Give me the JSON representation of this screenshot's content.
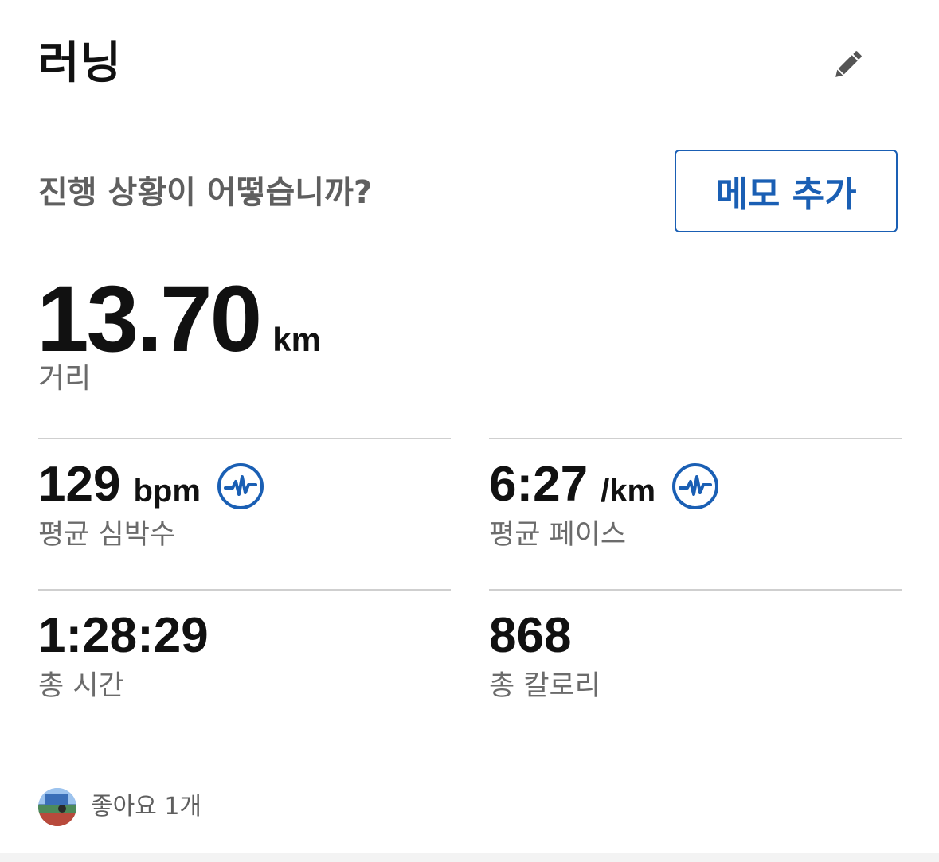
{
  "header": {
    "title": "러닝"
  },
  "prompt": {
    "question": "진행 상황이 어떻습니까?",
    "memo_button": "메모 추가"
  },
  "distance": {
    "value": "13.70",
    "unit": "km",
    "label": "거리"
  },
  "stats": [
    {
      "value": "129",
      "unit": "bpm",
      "label": "평균 심박수",
      "icon": "heart-rate-zone-icon"
    },
    {
      "value": "6:27",
      "unit": "/km",
      "label": "평균 페이스",
      "icon": "pace-zone-icon"
    },
    {
      "value": "1:28:29",
      "unit": "",
      "label": "총 시간"
    },
    {
      "value": "868",
      "unit": "",
      "label": "총 칼로리"
    }
  ],
  "likes": {
    "text": "좋아요 1개"
  },
  "colors": {
    "accent": "#1a5fb4",
    "text_primary": "#111111",
    "text_secondary": "#6b6b6b",
    "divider": "#cfcfcf"
  }
}
